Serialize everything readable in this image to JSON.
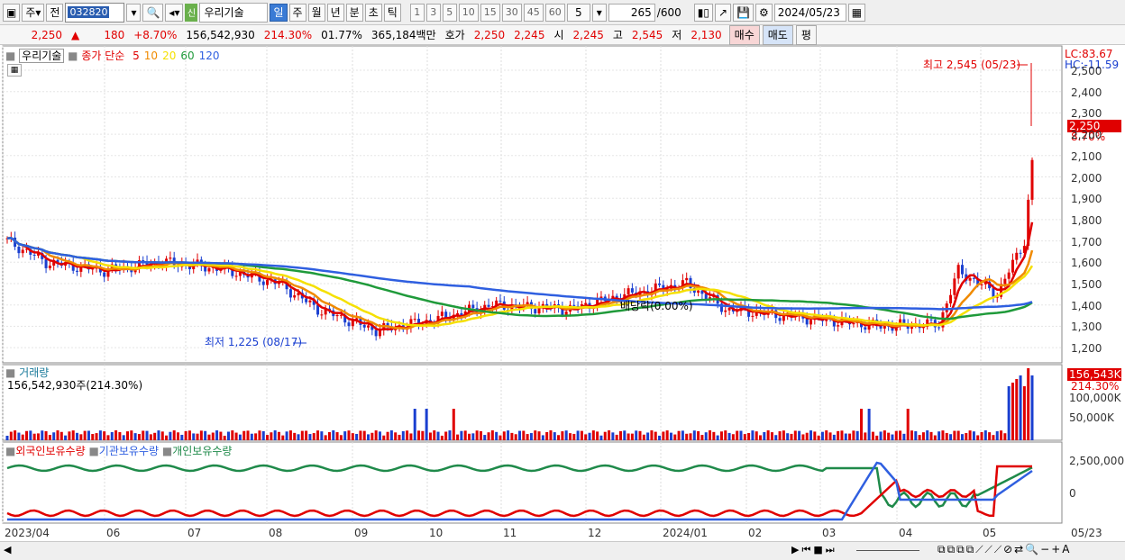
{
  "toolbar": {
    "period_type": "주",
    "prev_label": "전",
    "code": "032820",
    "badge": "신",
    "stock_name": "우리기술",
    "timeframes": [
      "일",
      "주",
      "월",
      "년",
      "분",
      "초",
      "틱"
    ],
    "active_timeframe": "일",
    "intervals": [
      "1",
      "3",
      "5",
      "10",
      "15",
      "30",
      "45",
      "60"
    ],
    "interval_value": "5",
    "count": "265",
    "count_total": "/600",
    "date": "2024/05/23"
  },
  "quote": {
    "price": "2,250",
    "arrow": "▲",
    "change": "180",
    "change_rate": "+8.70%",
    "volume": "156,542,930",
    "volume_ratio": "214.30%",
    "turnover": "01.77%",
    "amount": "365,184백만",
    "hoga_label": "호가",
    "ask": "2,250",
    "bid": "2,245",
    "open_label": "시",
    "open": "2,245",
    "high_label": "고",
    "high": "2,545",
    "low_label": "저",
    "low": "2,130",
    "buy": "매수",
    "sell": "매도",
    "avg": "평"
  },
  "price_panel": {
    "legend_name": "우리기술",
    "legend_ma": "종가 단순",
    "ma_periods": [
      "5",
      "10",
      "20",
      "60",
      "120"
    ],
    "ma_colors": [
      "#e00000",
      "#f08a00",
      "#f5e000",
      "#1f9a3a",
      "#2f5fe0"
    ],
    "lc": "LC:83.67",
    "hc": "HC:-11.59",
    "high_marker": "최고 2,545 (05/23)",
    "low_marker": "최저 1,225 (08/17)",
    "dividend": "배당락(0.00%)",
    "current_price_tag": "2,250",
    "current_rate_tag": "8.70%",
    "y_ticks": [
      "2,500",
      "2,400",
      "2,300",
      "2,200",
      "2,100",
      "2,000",
      "1,900",
      "1,800",
      "1,700",
      "1,600",
      "1,500",
      "1,400",
      "1,300",
      "1,200"
    ]
  },
  "volume_panel": {
    "title": "거래량",
    "value": "156,542,930주(214.30%)",
    "current_tag": "156,543K",
    "ratio_tag": "214.30%",
    "y_ticks": [
      "100,000K",
      "50,000K"
    ]
  },
  "holding_panel": {
    "series": [
      "외국인보유수량",
      "기관보유수량",
      "개인보유수량"
    ],
    "series_colors": [
      "#e00000",
      "#2f5fe0",
      "#1f8a4a"
    ],
    "y_ticks": [
      "2,500,000",
      "0"
    ]
  },
  "x_axis": [
    "2023/04",
    "06",
    "07",
    "08",
    "09",
    "10",
    "11",
    "12",
    "2024/01",
    "02",
    "03",
    "04",
    "05",
    "05/23"
  ]
}
